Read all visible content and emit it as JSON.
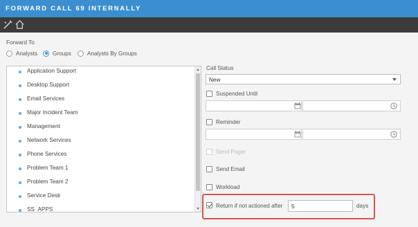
{
  "window": {
    "title": "FORWARD CALL 69 INTERNALLY"
  },
  "toolbar": {
    "icons": [
      "tools-icon",
      "home-icon"
    ]
  },
  "forward_to": {
    "label": "Forward To",
    "options": [
      "Analysts",
      "Groups",
      "Analysts By Groups"
    ],
    "selected": "Groups"
  },
  "groups": {
    "items": [
      "Application Support",
      "Desktop Support",
      "Email Services",
      "Major Incident Team",
      "Management",
      "Network Services",
      "Phone Services",
      "Problem Team 1",
      "Problem Team 2",
      "Service Desk",
      "SS_APPS"
    ]
  },
  "call_status": {
    "label": "Call Status",
    "value": "New"
  },
  "suspended_until": {
    "label": "Suspended Until",
    "checked": false
  },
  "reminder": {
    "label": "Reminder",
    "checked": false
  },
  "send_pager": {
    "label": "Send Pager",
    "disabled": true
  },
  "send_email": {
    "label": "Send Email",
    "checked": false
  },
  "workload": {
    "label": "Workload",
    "checked": false
  },
  "return_rule": {
    "label": "Return if not actioned after",
    "checked": true,
    "value": "5",
    "unit": "days"
  },
  "colors": {
    "titlebar": "#3b8fd0",
    "toolbar": "#3b3b3b",
    "highlight": "#d9534f",
    "bullet": "#6aa6d4"
  }
}
